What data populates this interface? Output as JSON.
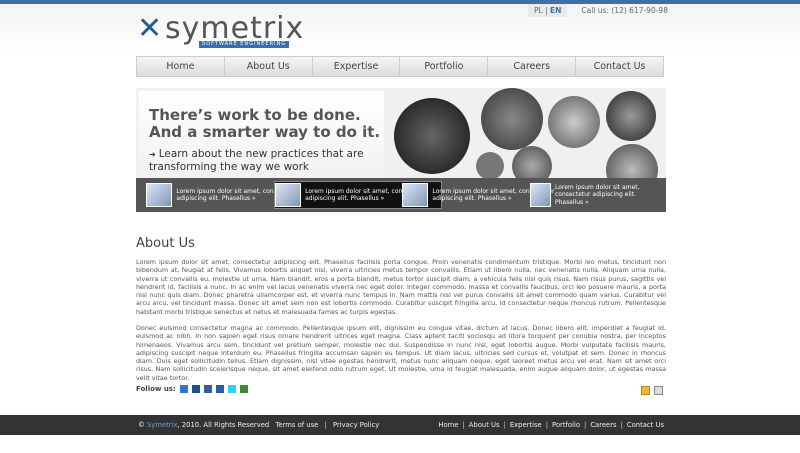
{
  "header": {
    "logo_mark": "✕",
    "logo_word": "symetrix",
    "logo_tag": "SOFTWARE ENGINEERING",
    "lang_pl": "PL",
    "lang_sep": "|",
    "lang_en": "EN",
    "phone": "Call us: (12) 617-90-98"
  },
  "nav": [
    "Home",
    "About Us",
    "Expertise",
    "Portfolio",
    "Careers",
    "Contact Us"
  ],
  "banner": {
    "line1": "There’s work to be done.",
    "line2": "And a smarter way to do it.",
    "sub": "Learn about the new practices that are transforming the way we work",
    "thumbs": [
      "Lorem ipsum dolor sit amet, consectetur adipiscing elit. Phasellus »",
      "Lorem ipsum dolor sit amet, consectetur adipiscing elit. Phasellus »",
      "Lorem ipsum dolor sit amet, consectetur adipiscing elit. Phasellus »",
      "Lorem ipsum dolor sit amet, consectetur adipiscing elit. Phasellus »"
    ]
  },
  "about": {
    "title": "About Us",
    "p1": "Lorem ipsum dolor sit amet, consectetur adipiscing elit. Phasellus facilisis porta congue. Proin venenatis condimentum tristique. Morbi leo metus, tincidunt non bibendum at, feugiat at felis. Vivamus lobortis aliquet nisl, viverra ultricies metus tempor convallis. Etiam ut libero nulla, nec venenatis nulla. Aliquam urna nulla, viverra ut convallis eu, molestie ut urna. Nam blandit, eros a porta blandit, metus tortor suscipit diam, a vehicula felis nisl quis risus. Nam risus purus, sagittis vel hendrerit id, facilisis a nunc. In ac enim vel lacus venenatis viverra nec eget dolor. Integer commodo, massa et convallis faucibus, orci leo posuere mauris, a porta nisl nunc quis diam. Donec pharetra ullamcorper est, et viverra nunc tempus in. Nam mattis nisl vel purus convallis sit amet commodo quam varius. Curabitur vel arcu arcu, vel tincidunt massa. Donec sit amet sem non est lobortis commodo. Curabitur suscipit fringilla arcu, id consectetur neque rhoncus rutrum. Pellentesque habitant morbi tristique senectus et netus et malesuada fames ac turpis egestas.",
    "p2": "Donec euismod consectetur magna ac commodo. Pellentesque ipsum elit, dignissim eu congue vitae, dictum at lacus. Donec libero elit, imperdiet a feugiat id, euismod ac nibh. In non sapien eget risus ornare hendrerit ultrices eget magna. Class aptent taciti sociosqu ad litora torquent per conubia nostra, per inceptos himenaeos. Vivamus arcu sem, tincidunt vel pretium semper, molestie nec dui. Suspendisse in nunc nisl, eget lobortis augue. Morbi vulputate facilisis mauris, adipiscing suscipit neque interdum eu. Phasellus fringilla accumsan sapien eu tempus. Ut diam lacus, ultricies sed cursus et, volutpat et sem. Donec in rhoncus diam. Duis eget sollicitudin tellus. Etiam dignissim, nisl vitae egestas hendrerit, metus nunc aliquam neque, eget laoreet metus arcu vel erat. Nam sit amet orci risus. Nam sollicitudin scelerisque neque, sit amet eleifend odio rutrum eget. Ut molestie, urna id feugiat malesuada, enim augue aliquam dolor, ut egestas massa velit vitae tortor."
  },
  "follow_label": "Follow us:",
  "social_icons": [
    {
      "name": "delicious-icon",
      "color": "#3274d0"
    },
    {
      "name": "digg-icon",
      "color": "#1d4f8a"
    },
    {
      "name": "facebook-icon",
      "color": "#3b5998"
    },
    {
      "name": "myspace-icon",
      "color": "#2a5caa"
    },
    {
      "name": "twitter-icon",
      "color": "#33ccff"
    },
    {
      "name": "stumbleupon-icon",
      "color": "#3b8b2f"
    }
  ],
  "footer": {
    "copy_symbol": "©",
    "brand": "Symetrix",
    "copy_rest": ", 2010. All Rights Reserved",
    "terms": "Terms of use",
    "privacy": "Privacy Policy",
    "links": [
      "Home",
      "About Us",
      "Expertise",
      "Portfolio",
      "Careers",
      "Contact Us"
    ]
  }
}
